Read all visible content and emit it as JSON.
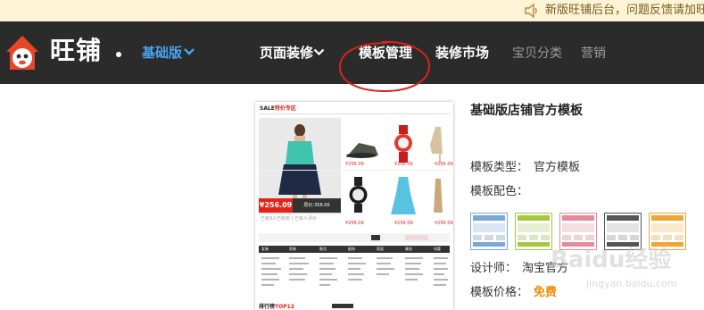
{
  "notice": {
    "text": "新版旺铺后台，问题反馈请加旺旺"
  },
  "nav": {
    "logo_text": "旺铺",
    "edition": "基础版",
    "items": [
      {
        "label": "页面装修",
        "style": "bold"
      },
      {
        "label": "模板管理",
        "style": "bold"
      },
      {
        "label": "装修市场",
        "style": "bold"
      },
      {
        "label": "宝贝分类",
        "style": "muted"
      },
      {
        "label": "营销",
        "style": "muted"
      }
    ],
    "highlight_color": "#d8241c"
  },
  "thumbnail": {
    "title_prefix": "SALE",
    "title_rest": "特价专区",
    "price_main": "¥256.09",
    "price_original": "原价:358.00",
    "sold_text": "已有9人已购买 | 已有人评价",
    "small_prices": [
      "¥256.09",
      "¥256.09",
      "¥256.09",
      "¥256.09",
      "¥256.09",
      "¥256.09"
    ],
    "cat_headers": [
      "女装",
      "男装",
      "鞋包",
      "配饰",
      "家居",
      "美妆",
      "母婴"
    ],
    "bottom_title_prefix": "排行榜",
    "bottom_title_rest": "TOP12"
  },
  "info": {
    "title": "基础版店铺官方模板",
    "type_label": "模板类型：",
    "type_value": "官方模板",
    "color_label": "模板配色：",
    "designer_label": "设计师：",
    "designer_value": "淘宝官方",
    "price_label": "模板价格：",
    "price_value": "免费"
  },
  "swatches": [
    {
      "name": "blue",
      "color": "#7aa7d9"
    },
    {
      "name": "green",
      "color": "#a4c93e"
    },
    {
      "name": "pink",
      "color": "#e58b99"
    },
    {
      "name": "gray",
      "color": "#555555"
    },
    {
      "name": "orange",
      "color": "#f0a535"
    }
  ],
  "watermark": {
    "brand": "Baidu经验",
    "url": "jingyan.baidu.com"
  }
}
